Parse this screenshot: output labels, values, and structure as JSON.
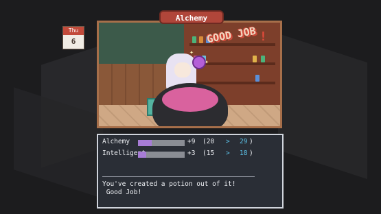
{
  "calendar": {
    "weekday": "Thu",
    "day": "6"
  },
  "scene": {
    "title": "Alchemy",
    "banner": "GOOD JOB",
    "banner_mark": "!"
  },
  "stats": [
    {
      "name": "Alchemy",
      "fill": 0.3,
      "gain": "+9",
      "old": "(20",
      "arrow": ">",
      "new": "29",
      "close": ")"
    },
    {
      "name": "Intelligent",
      "fill": 0.18,
      "gain": "+3",
      "old": "(15",
      "arrow": ">",
      "new": "18",
      "close": ")"
    }
  ],
  "message": {
    "line1": "You've created a potion out of it!",
    "line2": " Good Job!"
  },
  "colors": {
    "frame": "#a76f4a",
    "title_tab": "#b0463a",
    "bar_fill": "#a77cd6",
    "value_new": "#5cc2e8",
    "dialog_bg": "#2a2e36"
  }
}
